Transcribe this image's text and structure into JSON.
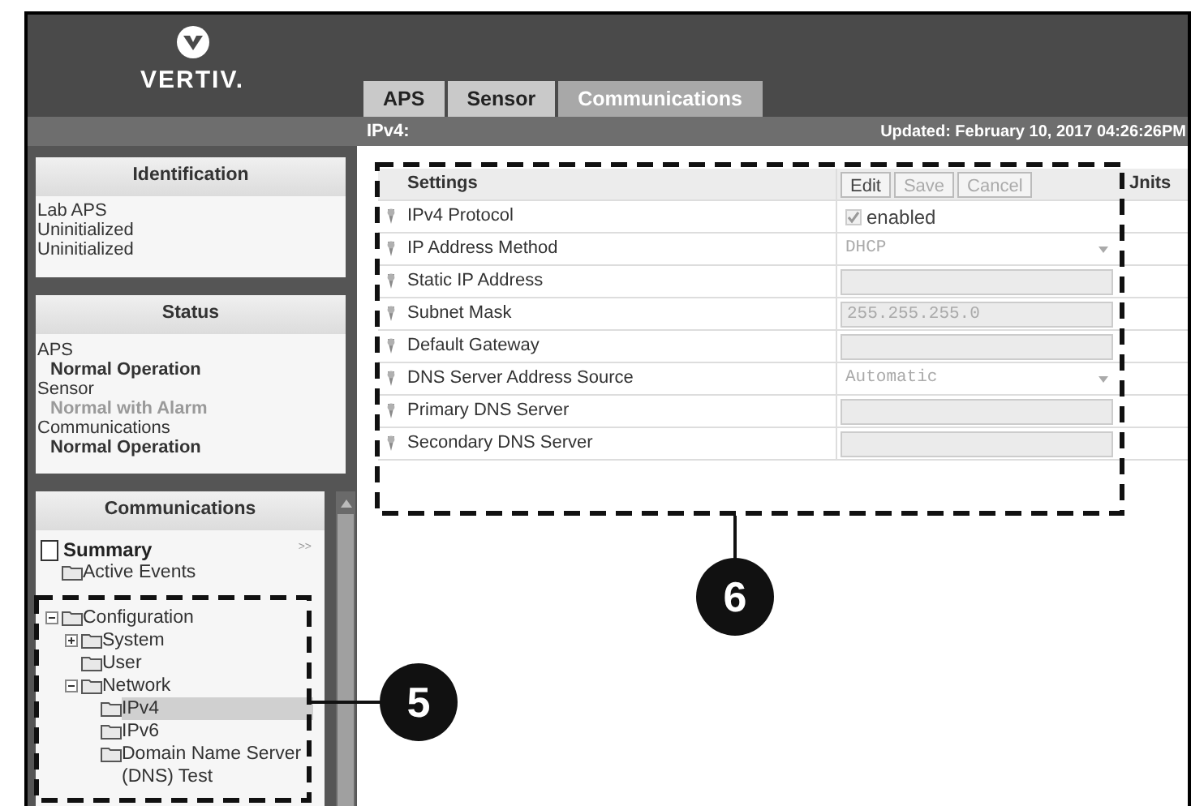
{
  "logo": {
    "text": "VERTIV."
  },
  "tabs": [
    {
      "label": "APS",
      "selected": false
    },
    {
      "label": "Sensor",
      "selected": false
    },
    {
      "label": "Communications",
      "selected": true
    }
  ],
  "subheader": {
    "title": "IPv4:",
    "updated": "Updated: February 10, 2017 04:26:26PM"
  },
  "identification": {
    "title": "Identification",
    "lines": [
      "Lab APS",
      "Uninitialized",
      "Uninitialized"
    ]
  },
  "status": {
    "title": "Status",
    "items": [
      {
        "name": "APS",
        "state": "Normal Operation",
        "alarm": false
      },
      {
        "name": "Sensor",
        "state": "Normal with Alarm",
        "alarm": true
      },
      {
        "name": "Communications",
        "state": "Normal Operation",
        "alarm": false
      }
    ]
  },
  "communications": {
    "title": "Communications",
    "more": ">>",
    "tree": [
      {
        "label": "Summary",
        "kind": "page",
        "children": [
          {
            "label": "Active Events",
            "kind": "folder"
          },
          {
            "label": "Configuration",
            "kind": "folder",
            "expanded": true,
            "children": [
              {
                "label": "System",
                "kind": "folder",
                "expanded": false
              },
              {
                "label": "User",
                "kind": "folder"
              },
              {
                "label": "Network",
                "kind": "folder",
                "expanded": true,
                "children": [
                  {
                    "label": "IPv4",
                    "kind": "folder",
                    "selected": true
                  },
                  {
                    "label": "IPv6",
                    "kind": "folder",
                    "selected": false
                  },
                  {
                    "label": "Domain Name Server (DNS) Test",
                    "kind": "folder",
                    "selected": false
                  }
                ]
              }
            ]
          }
        ]
      }
    ]
  },
  "settings": {
    "columns": [
      "Settings",
      "Jnits"
    ],
    "buttons": [
      {
        "label": "Edit",
        "disabled": false
      },
      {
        "label": "Save",
        "disabled": true
      },
      {
        "label": "Cancel",
        "disabled": true
      }
    ],
    "rows": [
      {
        "label": "IPv4 Protocol",
        "kind": "checkbox",
        "value": "enabled",
        "checked": true
      },
      {
        "label": "IP Address Method",
        "kind": "select",
        "value": "DHCP"
      },
      {
        "label": "Static IP Address",
        "kind": "input"
      },
      {
        "label": "Subnet Mask",
        "kind": "input",
        "value": "255.255.255.0"
      },
      {
        "label": "Default Gateway",
        "kind": "input"
      },
      {
        "label": "DNS Server Address Source",
        "kind": "select",
        "value": "Automatic"
      },
      {
        "label": "Primary DNS Server",
        "kind": "input"
      },
      {
        "label": "Secondary DNS Server",
        "kind": "input"
      }
    ]
  },
  "callouts": [
    {
      "number": "5"
    },
    {
      "number": "6"
    }
  ]
}
